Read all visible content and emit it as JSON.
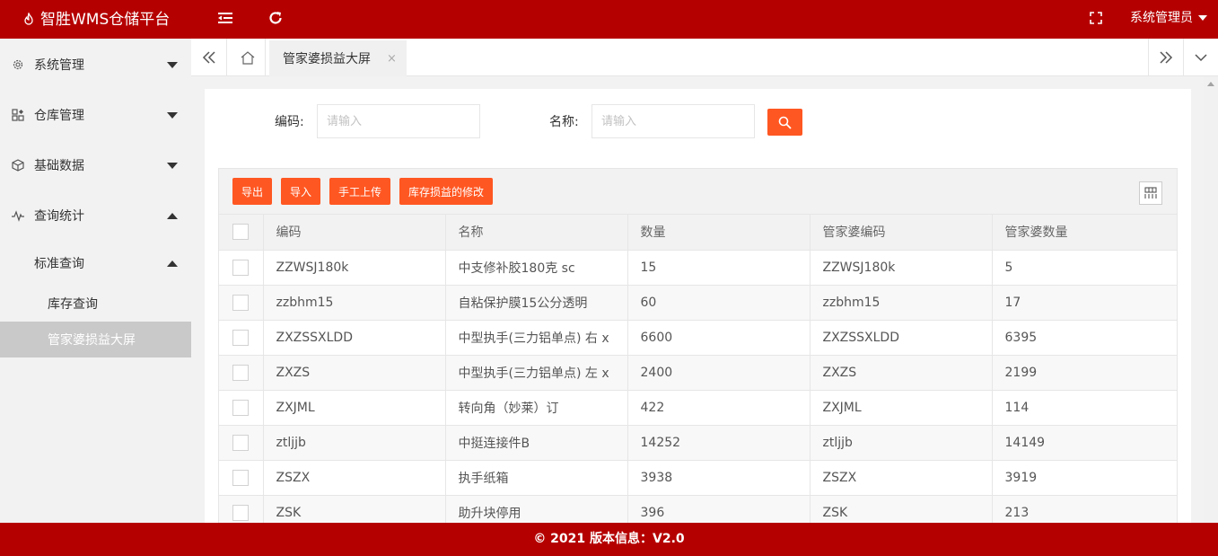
{
  "header": {
    "app_title": "智胜WMS仓储平台",
    "user_name": "系统管理员",
    "brand_color": "#b50000"
  },
  "sidebar": {
    "items": [
      {
        "label": "系统管理",
        "icon": "gear-icon",
        "expanded": false
      },
      {
        "label": "仓库管理",
        "icon": "warehouse-icon",
        "expanded": false
      },
      {
        "label": "基础数据",
        "icon": "cube-icon",
        "expanded": false
      },
      {
        "label": "查询统计",
        "icon": "pulse-icon",
        "expanded": true
      }
    ],
    "submenu": {
      "label": "标准查询",
      "expanded": true,
      "children": [
        {
          "label": "库存查询",
          "active": false
        },
        {
          "label": "管家婆损益大屏",
          "active": true
        }
      ]
    }
  },
  "tabs": {
    "active_label": "管家婆损益大屏",
    "close_glyph": "×"
  },
  "search": {
    "code_label": "编码:",
    "code_placeholder": "请输入",
    "name_label": "名称:",
    "name_placeholder": "请输入"
  },
  "toolbar": {
    "export_label": "导出",
    "import_label": "导入",
    "manual_upload_label": "手工上传",
    "modify_label": "库存损益的修改",
    "accent_color": "#ff5722"
  },
  "table": {
    "columns": [
      "编码",
      "名称",
      "数量",
      "管家婆编码",
      "管家婆数量"
    ],
    "rows": [
      [
        "ZZWSJ180k",
        "中支修补胶180克 sc",
        "15",
        "ZZWSJ180k",
        "5"
      ],
      [
        "zzbhm15",
        "自粘保护膜15公分透明",
        "60",
        "zzbhm15",
        "17"
      ],
      [
        "ZXZSSXLDD",
        "中型执手(三力铝单点) 右 x",
        "6600",
        "ZXZSSXLDD",
        "6395"
      ],
      [
        "ZXZS",
        "中型执手(三力铝单点) 左 x",
        "2400",
        "ZXZS",
        "2199"
      ],
      [
        "ZXJML",
        "转向角（妙莱）订",
        "422",
        "ZXJML",
        "114"
      ],
      [
        "ztljjb",
        "中挺连接件B",
        "14252",
        "ztljjb",
        "14149"
      ],
      [
        "ZSZX",
        "执手纸箱",
        "3938",
        "ZSZX",
        "3919"
      ],
      [
        "ZSK",
        "助升块停用",
        "396",
        "ZSK",
        "213"
      ]
    ]
  },
  "footer": {
    "text": "© 2021 版本信息：V2.0"
  }
}
